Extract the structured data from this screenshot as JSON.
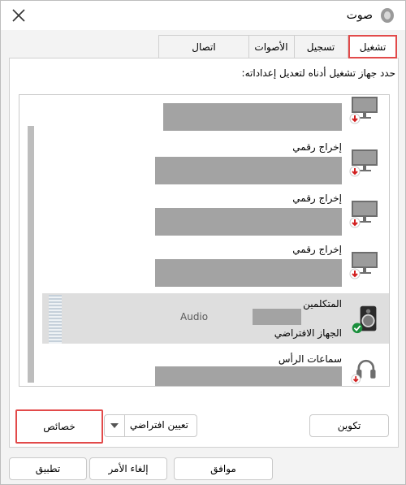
{
  "window": {
    "title": "صوت"
  },
  "tabs": [
    {
      "label": "تشغيل"
    },
    {
      "label": "تسجيل"
    },
    {
      "label": "الأصوات"
    },
    {
      "label": "اتصال"
    }
  ],
  "instruction": "حدد جهاز تشغيل أدناه لتعديل إعداداته:",
  "devices": [
    {
      "name": ""
    },
    {
      "name": "إخراج رقمي"
    },
    {
      "name": "إخراج رقمي"
    },
    {
      "name": "إخراج رقمي"
    },
    {
      "name": "المتكلمين",
      "sub": "Audio",
      "status": "الجهاز الافتراضي"
    },
    {
      "name": "سماعات الرأس"
    }
  ],
  "buttons": {
    "configure": "تكوين",
    "set_default": "تعيين افتراضي",
    "properties": "خصائص",
    "ok": "موافق",
    "cancel": "إلغاء الأمر",
    "apply": "تطبيق"
  },
  "colors": {
    "highlight": "#e24a4a",
    "placeholder_bar": "#a3a3a3",
    "default_check": "#1a8f3c",
    "disabled_arrow": "#d21f1f"
  }
}
